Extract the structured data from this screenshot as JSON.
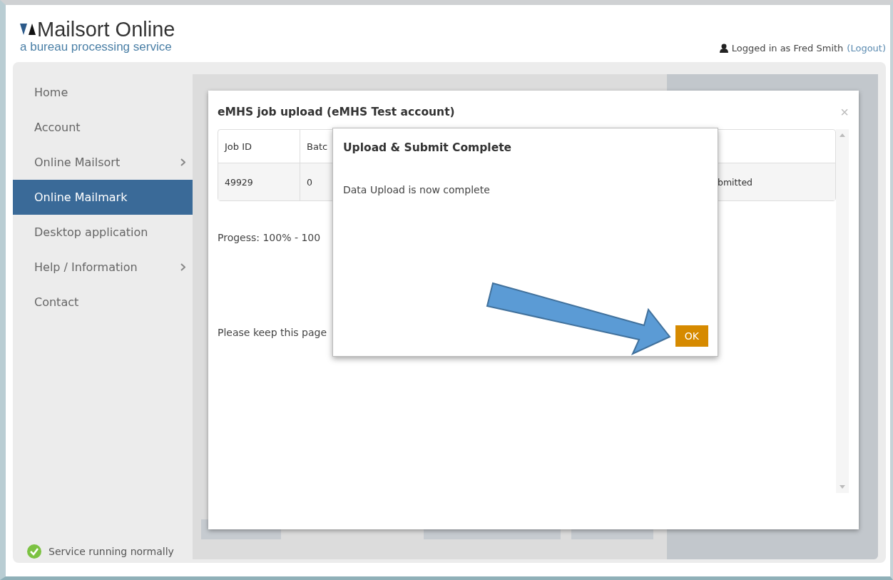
{
  "header": {
    "title": "Mailsort Online",
    "tagline": "a bureau processing service",
    "user_text": "Logged in as Fred Smith",
    "logout_link": "(Logout)"
  },
  "sidebar": {
    "items": [
      {
        "label": "Home",
        "selected": false,
        "submenu": false
      },
      {
        "label": "Account",
        "selected": false,
        "submenu": false
      },
      {
        "label": "Online Mailsort",
        "selected": false,
        "submenu": true
      },
      {
        "label": "Online Mailmark",
        "selected": true,
        "submenu": false
      },
      {
        "label": "Desktop application",
        "selected": false,
        "submenu": false
      },
      {
        "label": "Help / Information",
        "selected": false,
        "submenu": true
      },
      {
        "label": "Contact",
        "selected": false,
        "submenu": false
      }
    ]
  },
  "status": {
    "text": "Service running normally"
  },
  "modal": {
    "title": "eMHS job upload (eMHS Test account)",
    "close": "×",
    "table": {
      "columns": [
        "Job ID",
        "Batc"
      ],
      "rows": [
        [
          "49929",
          "0",
          "bmitted"
        ]
      ]
    },
    "progress_text": "Progess: 100% - 100",
    "notice_text": "Please keep this page"
  },
  "dialog": {
    "title": "Upload & Submit Complete",
    "message": "Data Upload is now complete",
    "button": "OK"
  }
}
